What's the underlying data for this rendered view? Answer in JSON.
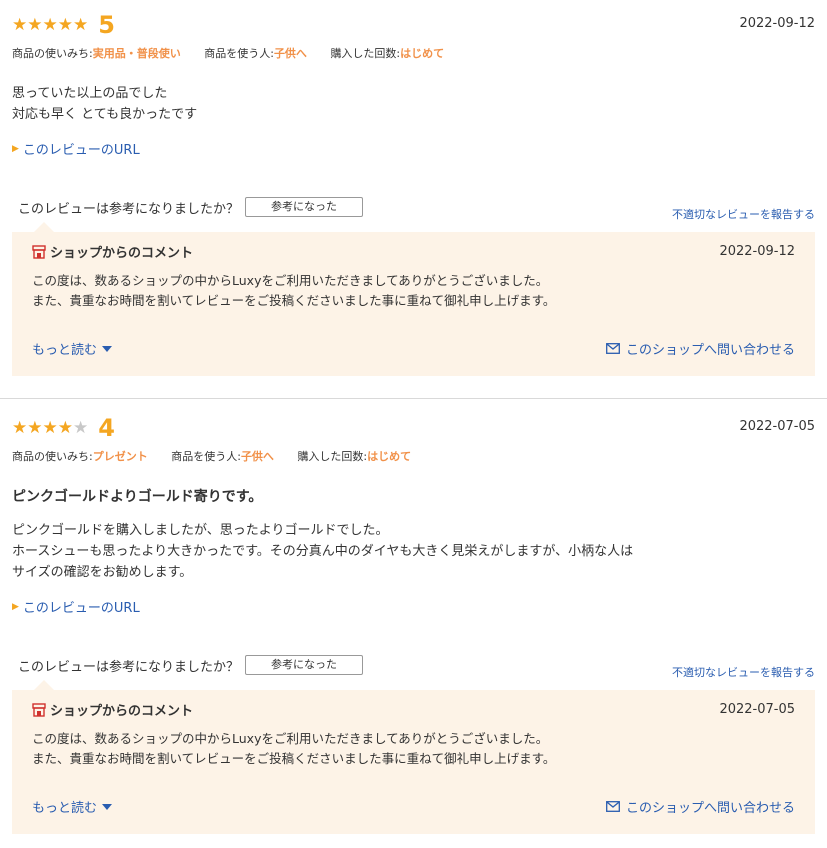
{
  "labels": {
    "usage": "商品の使いみち:",
    "user": "商品を使う人:",
    "count": "購入した回数:",
    "review_url": "このレビューのURL",
    "helpful_q": "このレビューは参考になりましたか？",
    "helpful_btn": "参考になった",
    "report": "不適切なレビューを報告する",
    "shop_comment": "ショップからのコメント",
    "more": "もっと読む",
    "contact": "このショップへ問い合わせる"
  },
  "reviews": [
    {
      "rating": 5,
      "stars_text_on": "★★★★★",
      "stars_text_off": "",
      "score": "5",
      "date": "2022-09-12",
      "usage": "実用品・普段使い",
      "user": "子供へ",
      "count": "はじめて",
      "title": "",
      "body": [
        "思っていた以上の品でした",
        "対応も早く とても良かったです"
      ],
      "shop_date": "2022-09-12",
      "shop_body": [
        "この度は、数あるショップの中からLuxyをご利用いただきましてありがとうございました。",
        "また、貴重なお時間を割いてレビューをご投稿くださいました事に重ねて御礼申し上げます。"
      ]
    },
    {
      "rating": 4,
      "stars_text_on": "★★★★",
      "stars_text_off": "★",
      "score": "4",
      "date": "2022-07-05",
      "usage": "プレゼント",
      "user": "子供へ",
      "count": "はじめて",
      "title": "ピンクゴールドよりゴールド寄りです。",
      "body": [
        "ピンクゴールドを購入しましたが、思ったよりゴールドでした。",
        "ホースシューも思ったより大きかったです。その分真ん中のダイヤも大きく見栄えがしますが、小柄な人は",
        "サイズの確認をお勧めします。"
      ],
      "shop_date": "2022-07-05",
      "shop_body": [
        "この度は、数あるショップの中からLuxyをご利用いただきましてありがとうございました。",
        "また、貴重なお時間を割いてレビューをご投稿くださいました事に重ねて御礼申し上げます。"
      ]
    }
  ],
  "colors": {
    "star": "#f4a621",
    "accent": "#f19149",
    "link": "#2a5db0",
    "shop_bg": "#fdf3e7"
  }
}
